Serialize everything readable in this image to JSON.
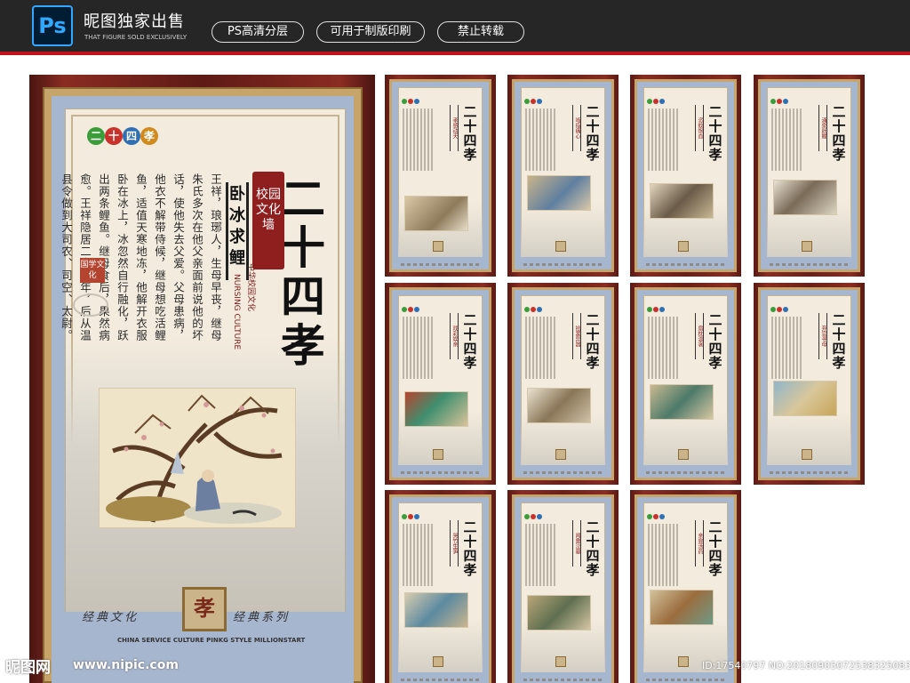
{
  "header": {
    "ps_logo": "Ps",
    "brand_name": "昵图独家出售",
    "brand_sub": "THAT FIGURE SOLD EXCLUSIVELY",
    "pills": [
      "PS高清分层",
      "可用于制版印刷",
      "禁止转载"
    ]
  },
  "main_poster": {
    "badges": [
      "二",
      "十",
      "四",
      "孝"
    ],
    "badge_colors": [
      "#3a9d3a",
      "#c8322b",
      "#2f6fb3",
      "#d08a1e"
    ],
    "title": "二十四孝",
    "banner": "校园文化墙",
    "story_title": "卧冰求鲤",
    "eng_vertical": "NURSING CULTURE",
    "cn_vertical": "中华校园文化",
    "story": "王祥，琅琊人，生母早丧，继母朱氏多次在他父亲面前说他的坏话，使他失去父爱。父母患病，他衣不解带侍候，继母想吃活鲤鱼，适值天寒地冻，他解开衣服卧在冰上，冰忽然自行融化，跃出两条鲤鱼。继母食后，果然病愈。王祥隐居二十余年，后从温县令做到大司农、司空、太尉。",
    "seal_text": "国学文化",
    "center_seal": "孝",
    "classics_left": "经典文化",
    "classics_right": "经典系列",
    "footer_en": "CHINA SERVICE CULTURE PINKG STYLE MILLIONSTART"
  },
  "thumbnails": [
    {
      "title": "二十四孝",
      "label": "孝感动天"
    },
    {
      "title": "二十四孝",
      "label": "啮指痛心"
    },
    {
      "title": "二十四孝",
      "label": "恣蚊饱血"
    },
    {
      "title": "二十四孝",
      "label": "涌泉跃鲤"
    },
    {
      "title": "二十四孝",
      "label": "戏彩娱亲"
    },
    {
      "title": "二十四孝",
      "label": "拾葚异器"
    },
    {
      "title": "二十四孝",
      "label": "扇枕温衾"
    },
    {
      "title": "二十四孝",
      "label": "弃官寻母"
    },
    {
      "title": "二十四孝",
      "label": "哭竹生笋"
    },
    {
      "title": "二十四孝",
      "label": "闻雷泣墓"
    },
    {
      "title": "二十四孝",
      "label": "亲尝汤药"
    }
  ],
  "watermark": {
    "logo": "昵图网",
    "url": "www.nipic.com",
    "id": "ID:17540797 NO:20180905072538325083"
  }
}
